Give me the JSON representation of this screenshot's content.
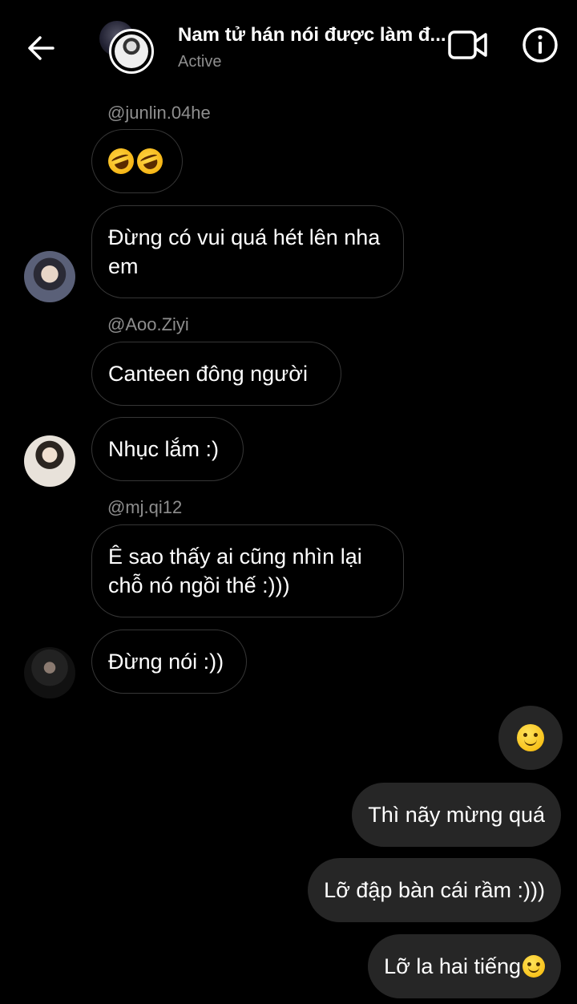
{
  "header": {
    "title": "Nam tử hán nói được làm đ...",
    "status": "Active"
  },
  "messages": {
    "s1": "@junlin.04he",
    "m2": "Đừng có vui quá hét lên nha em",
    "s2": "@Aoo.Ziyi",
    "m3": "Canteen đông người",
    "m4": "Nhục lắm :)",
    "s3": "@mj.qi12",
    "m5": "Ê sao thấy ai cũng nhìn lại chỗ nó ngồi thế :)))",
    "m6": "Đừng nói :))",
    "o1": "Thì nãy mừng quá",
    "o2": "Lỡ đập bàn cái rầm :)))",
    "o3": "Lỡ la hai tiếng"
  },
  "icons": {
    "laugh": "rolling-on-floor-laughing-emoji",
    "smile": "slightly-smiling-face-emoji"
  }
}
